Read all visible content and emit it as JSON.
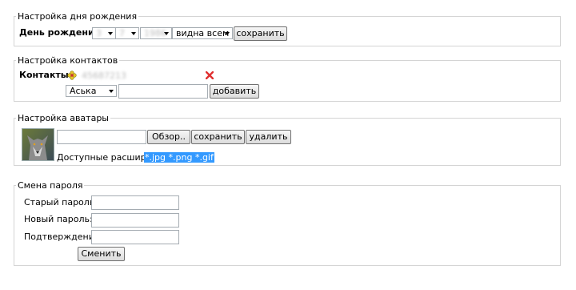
{
  "birthday": {
    "legend": "Настройка дня рождения",
    "label": "День рождения",
    "day": "3",
    "month": "7",
    "year": "1986",
    "visibility": "видна всем",
    "save_label": "сохранить"
  },
  "contacts": {
    "legend": "Настройка контактов",
    "label": "Контакты",
    "existing_value": "45687213",
    "type_selected": "Аська",
    "contact_input": "",
    "add_label": "добавить"
  },
  "avatar": {
    "legend": "Настройка аватары",
    "file_input": "",
    "browse_label": "Обзор..",
    "save_label": "сохранить",
    "delete_label": "удалить",
    "extensions_label": "Доступные расширения",
    "extensions": "*.jpg *.png *.gif"
  },
  "password": {
    "legend": "Смена пароля",
    "old_label": "Старый пароль:",
    "new_label": "Новый пароль:",
    "confirm_label": "Подтверждение:",
    "submit_label": "Сменить"
  }
}
